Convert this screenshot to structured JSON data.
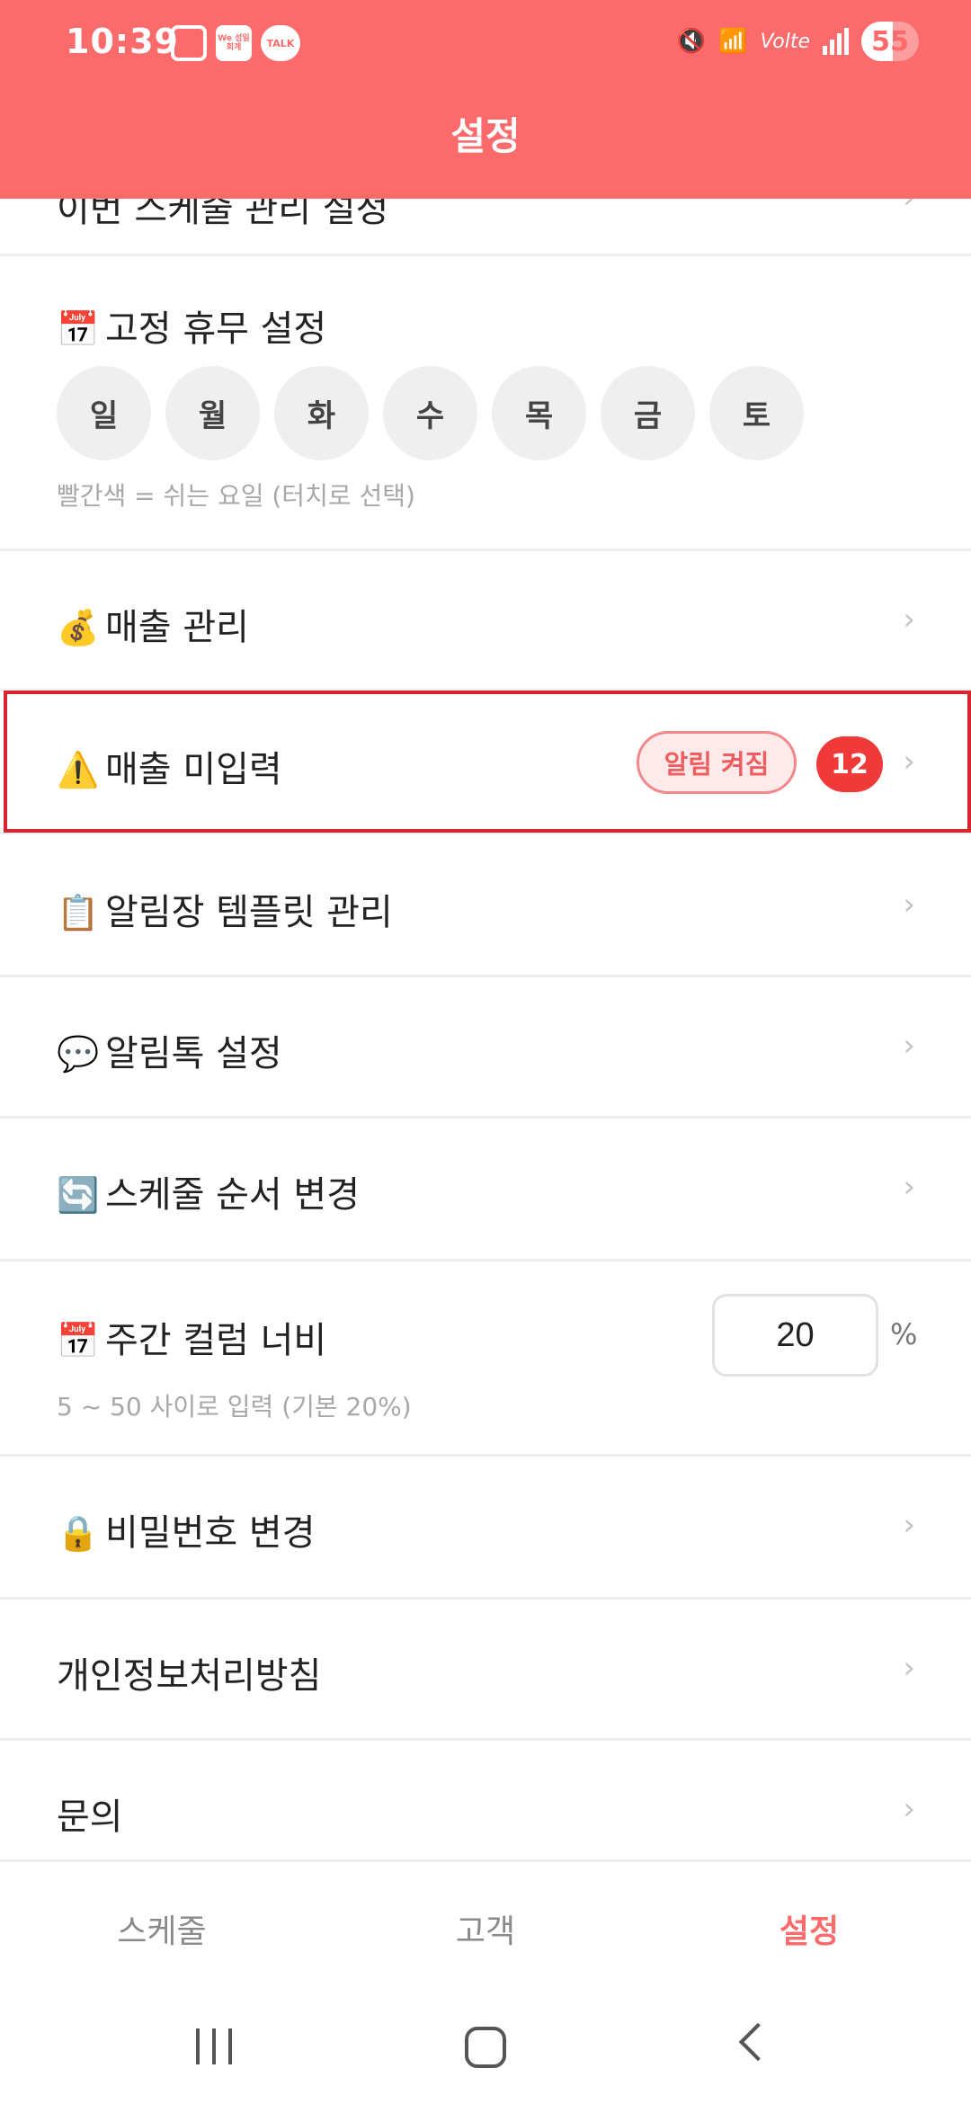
{
  "status_bar": {
    "time": "10:39",
    "app_icon_text": "We 성일회계",
    "talk_icon_text": "TALK",
    "network": "Volte",
    "battery": "55"
  },
  "header": {
    "title": "설정"
  },
  "rows": {
    "partial_label": "이번 스케줄 관리 설정",
    "holiday": {
      "emoji": "📅",
      "label": "고정 휴무 설정",
      "days": [
        "일",
        "월",
        "화",
        "수",
        "목",
        "금",
        "토"
      ],
      "hint": "빨간색 = 쉬는 요일 (터치로 선택)"
    },
    "sales": {
      "emoji": "💰",
      "label": "매출 관리"
    },
    "sales_missing": {
      "emoji": "⚠️",
      "label": "매출 미입력",
      "pill": "알림 켜짐",
      "badge": "12"
    },
    "template": {
      "emoji": "📋",
      "label": "알림장 템플릿 관리"
    },
    "talk": {
      "emoji": "💬",
      "label": "알림톡 설정"
    },
    "order": {
      "emoji": "🔄",
      "label": "스케줄 순서 변경"
    },
    "width": {
      "emoji": "📅",
      "label": "주간 컬럼 너비",
      "value": "20",
      "unit": "%",
      "hint": "5 ~ 50 사이로 입력 (기본 20%)"
    },
    "password": {
      "emoji": "🔒",
      "label": "비밀번호 변경"
    },
    "privacy": {
      "label": "개인정보처리방침"
    },
    "inquiry": {
      "label": "문의"
    }
  },
  "chevron": "›",
  "tabs": [
    {
      "label": "스케줄"
    },
    {
      "label": "고객"
    },
    {
      "label": "설정"
    }
  ],
  "colors": {
    "accent": "#fb6b6b",
    "highlight_border": "#d6262f",
    "badge": "#f03a3a"
  }
}
